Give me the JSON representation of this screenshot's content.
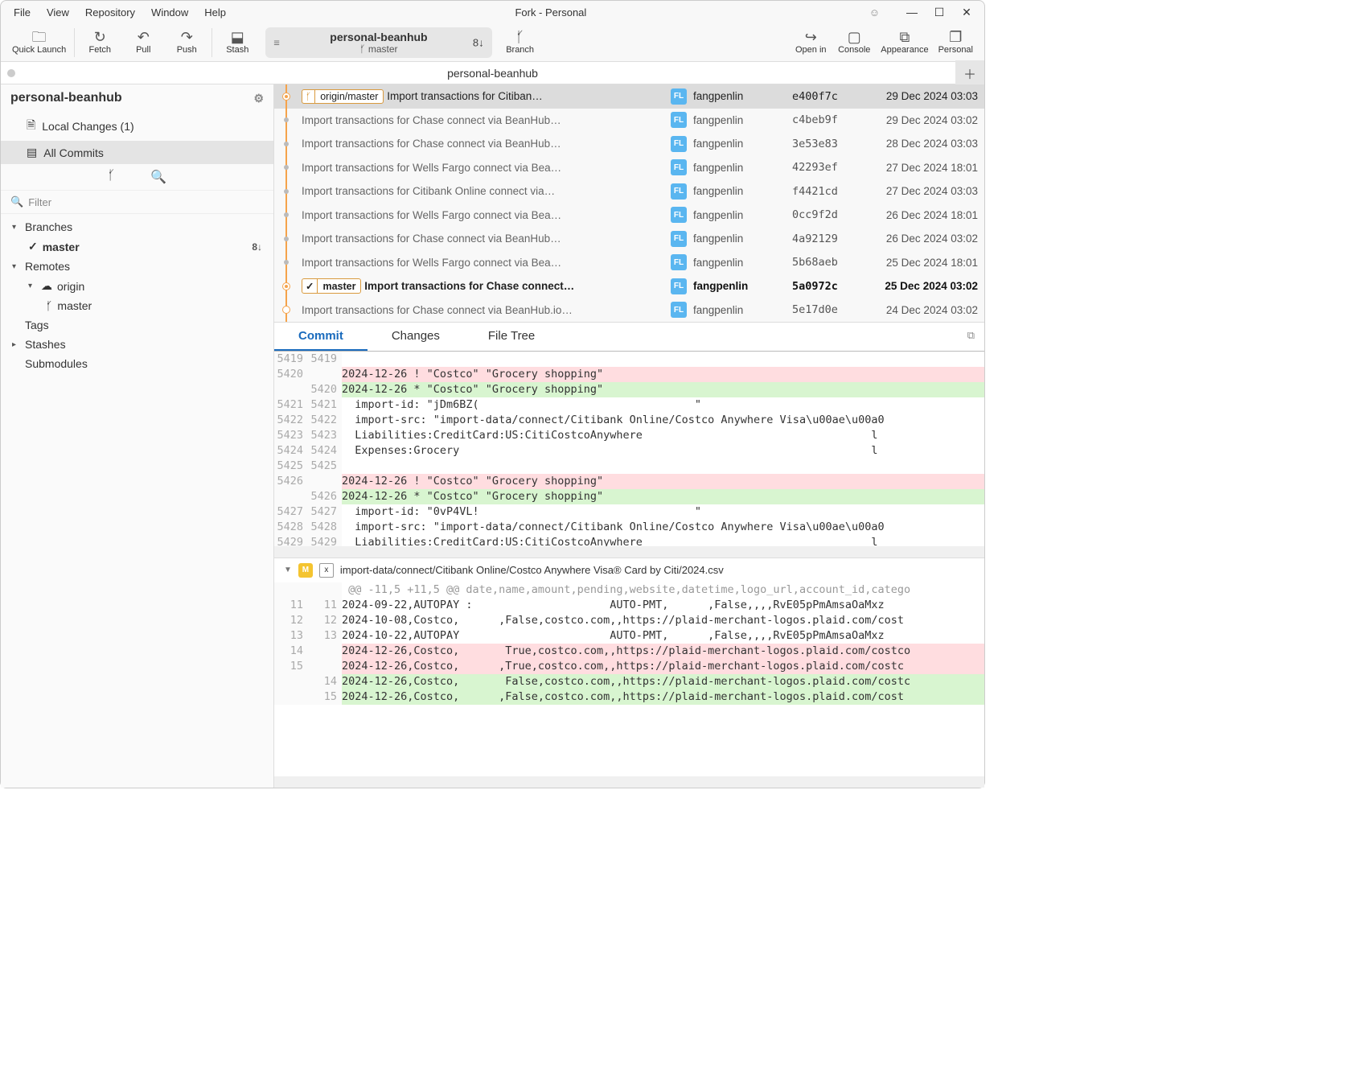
{
  "title": "Fork - Personal",
  "menu": [
    "File",
    "View",
    "Repository",
    "Window",
    "Help"
  ],
  "toolbar": {
    "quick_launch": "Quick Launch",
    "fetch": "Fetch",
    "pull": "Pull",
    "push": "Push",
    "stash": "Stash",
    "branch": "Branch",
    "open_in": "Open in",
    "console": "Console",
    "appearance": "Appearance",
    "personal": "Personal"
  },
  "repo_pill": {
    "name": "personal-beanhub",
    "branch": "master",
    "count": "8↓"
  },
  "tab": {
    "name": "personal-beanhub"
  },
  "sidebar": {
    "repo": "personal-beanhub",
    "local_changes": "Local Changes (1)",
    "all_commits": "All Commits",
    "filter": "Filter",
    "branches": "Branches",
    "master": "master",
    "master_ahead": "8↓",
    "remotes": "Remotes",
    "origin": "origin",
    "origin_master": "master",
    "tags": "Tags",
    "stashes": "Stashes",
    "submodules": "Submodules"
  },
  "commits": [
    {
      "badge": "origin/master",
      "msg": "Import transactions for Citiban…",
      "author": "fangpenlin",
      "hash": "e400f7c",
      "date": "29 Dec 2024 03:03",
      "head": true,
      "sel": true
    },
    {
      "msg": "Import transactions for Chase connect via BeanHub…",
      "author": "fangpenlin",
      "hash": "c4beb9f",
      "date": "29 Dec 2024 03:02"
    },
    {
      "msg": "Import transactions for Chase connect via BeanHub…",
      "author": "fangpenlin",
      "hash": "3e53e83",
      "date": "28 Dec 2024 03:03"
    },
    {
      "msg": "Import transactions for Wells Fargo connect via Bea…",
      "author": "fangpenlin",
      "hash": "42293ef",
      "date": "27 Dec 2024 18:01"
    },
    {
      "msg": "Import transactions for Citibank Online connect via…",
      "author": "fangpenlin",
      "hash": "f4421cd",
      "date": "27 Dec 2024 03:03"
    },
    {
      "msg": "Import transactions for Wells Fargo connect via Bea…",
      "author": "fangpenlin",
      "hash": "0cc9f2d",
      "date": "26 Dec 2024 18:01"
    },
    {
      "msg": "Import transactions for Chase connect via BeanHub…",
      "author": "fangpenlin",
      "hash": "4a92129",
      "date": "26 Dec 2024 03:02"
    },
    {
      "msg": "Import transactions for Wells Fargo connect via Bea…",
      "author": "fangpenlin",
      "hash": "5b68aeb",
      "date": "25 Dec 2024 18:01"
    },
    {
      "badge": "master",
      "tick": true,
      "msg": "Import transactions for Chase connect…",
      "author": "fangpenlin",
      "hash": "5a0972c",
      "date": "25 Dec 2024 03:02",
      "bold": true
    },
    {
      "msg": "Import transactions for Chase connect via BeanHub.io…",
      "author": "fangpenlin",
      "hash": "5e17d0e",
      "date": "24 Dec 2024 03:02",
      "plain": true
    }
  ],
  "dtabs": {
    "commit": "Commit",
    "changes": "Changes",
    "file_tree": "File Tree"
  },
  "diff1": {
    "lines": [
      {
        "l": "5419",
        "r": "5419",
        "t": "",
        "c": ""
      },
      {
        "l": "5420",
        "r": "",
        "t": "2024-12-26 ! \"Costco\" \"Grocery shopping\"",
        "c": "del"
      },
      {
        "l": "",
        "r": "5420",
        "t": "2024-12-26 * \"Costco\" \"Grocery shopping\"",
        "c": "add"
      },
      {
        "l": "5421",
        "r": "5421",
        "t": "  import-id: \"jDm6BZ(                                 \"",
        "c": ""
      },
      {
        "l": "5422",
        "r": "5422",
        "t": "  import-src: \"import-data/connect/Citibank Online/Costco Anywhere Visa\\u00ae\\u00a0",
        "c": ""
      },
      {
        "l": "5423",
        "r": "5423",
        "t": "  Liabilities:CreditCard:US:CitiCostcoAnywhere                                   l",
        "c": ""
      },
      {
        "l": "5424",
        "r": "5424",
        "t": "  Expenses:Grocery                                                               l",
        "c": ""
      },
      {
        "l": "5425",
        "r": "5425",
        "t": "",
        "c": ""
      },
      {
        "l": "5426",
        "r": "",
        "t": "2024-12-26 ! \"Costco\" \"Grocery shopping\"",
        "c": "del"
      },
      {
        "l": "",
        "r": "5426",
        "t": "2024-12-26 * \"Costco\" \"Grocery shopping\"",
        "c": "add"
      },
      {
        "l": "5427",
        "r": "5427",
        "t": "  import-id: \"0vP4VL!                                 \"",
        "c": ""
      },
      {
        "l": "5428",
        "r": "5428",
        "t": "  import-src: \"import-data/connect/Citibank Online/Costco Anywhere Visa\\u00ae\\u00a0",
        "c": ""
      },
      {
        "l": "5429",
        "r": "5429",
        "t": "  Liabilities:CreditCard:US:CitiCostcoAnywhere                                   l",
        "c": ""
      }
    ]
  },
  "file2": {
    "path": "import-data/connect/Citibank Online/Costco Anywhere Visa® Card by Citi/2024.csv",
    "hunk": "@@ -11,5 +11,5 @@ date,name,amount,pending,website,datetime,logo_url,account_id,catego",
    "lines": [
      {
        "l": "11",
        "r": "11",
        "t": "2024-09-22,AUTOPAY :                     AUTO-PMT,      ,False,,,,RvE05pPmAmsaOaMxz",
        "c": ""
      },
      {
        "l": "12",
        "r": "12",
        "t": "2024-10-08,Costco,      ,False,costco.com,,https://plaid-merchant-logos.plaid.com/cost",
        "c": ""
      },
      {
        "l": "13",
        "r": "13",
        "t": "2024-10-22,AUTOPAY                       AUTO-PMT,      ,False,,,,RvE05pPmAmsaOaMxz",
        "c": ""
      },
      {
        "l": "14",
        "r": "",
        "t": "2024-12-26,Costco,       True,costco.com,,https://plaid-merchant-logos.plaid.com/costco",
        "c": "del"
      },
      {
        "l": "15",
        "r": "",
        "t": "2024-12-26,Costco,      ,True,costco.com,,https://plaid-merchant-logos.plaid.com/costc",
        "c": "del"
      },
      {
        "l": "",
        "r": "14",
        "t": "2024-12-26,Costco,       False,costco.com,,https://plaid-merchant-logos.plaid.com/costc",
        "c": "add"
      },
      {
        "l": "",
        "r": "15",
        "t": "2024-12-26,Costco,      ,False,costco.com,,https://plaid-merchant-logos.plaid.com/cost",
        "c": "add"
      }
    ]
  }
}
